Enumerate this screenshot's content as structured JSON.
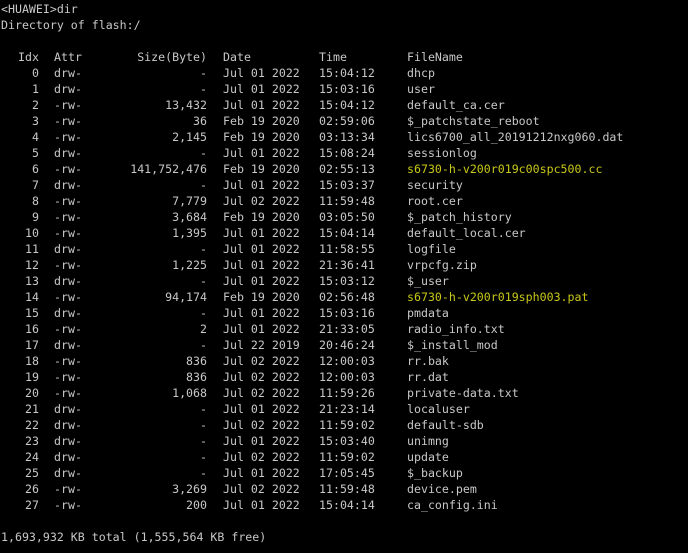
{
  "terminal": {
    "prompt": "<HUAWEI>dir",
    "directory": "Directory of flash:/",
    "headers": {
      "idx": "Idx",
      "attr": "Attr",
      "size": "Size(Byte)",
      "date": "Date",
      "time": "Time",
      "filename": "FileName"
    },
    "rows": [
      {
        "idx": "0",
        "attr": "drw-",
        "size": "-",
        "date": "Jul 01 2022",
        "time": "15:04:12",
        "name": "dhcp",
        "highlight": false
      },
      {
        "idx": "1",
        "attr": "drw-",
        "size": "-",
        "date": "Jul 01 2022",
        "time": "15:03:16",
        "name": "user",
        "highlight": false
      },
      {
        "idx": "2",
        "attr": "-rw-",
        "size": "13,432",
        "date": "Jul 01 2022",
        "time": "15:04:12",
        "name": "default_ca.cer",
        "highlight": false
      },
      {
        "idx": "3",
        "attr": "-rw-",
        "size": "36",
        "date": "Feb 19 2020",
        "time": "02:59:06",
        "name": "$_patchstate_reboot",
        "highlight": false
      },
      {
        "idx": "4",
        "attr": "-rw-",
        "size": "2,145",
        "date": "Feb 19 2020",
        "time": "03:13:34",
        "name": "lics6700_all_20191212nxg060.dat",
        "highlight": false
      },
      {
        "idx": "5",
        "attr": "drw-",
        "size": "-",
        "date": "Jul 01 2022",
        "time": "15:08:24",
        "name": "sessionlog",
        "highlight": false
      },
      {
        "idx": "6",
        "attr": "-rw-",
        "size": "141,752,476",
        "date": "Feb 19 2020",
        "time": "02:55:13",
        "name": "s6730-h-v200r019c00spc500.cc",
        "highlight": true
      },
      {
        "idx": "7",
        "attr": "drw-",
        "size": "-",
        "date": "Jul 01 2022",
        "time": "15:03:37",
        "name": "security",
        "highlight": false
      },
      {
        "idx": "8",
        "attr": "-rw-",
        "size": "7,779",
        "date": "Jul 02 2022",
        "time": "11:59:48",
        "name": "root.cer",
        "highlight": false
      },
      {
        "idx": "9",
        "attr": "-rw-",
        "size": "3,684",
        "date": "Feb 19 2020",
        "time": "03:05:50",
        "name": "$_patch_history",
        "highlight": false
      },
      {
        "idx": "10",
        "attr": "-rw-",
        "size": "1,395",
        "date": "Jul 01 2022",
        "time": "15:04:14",
        "name": "default_local.cer",
        "highlight": false
      },
      {
        "idx": "11",
        "attr": "drw-",
        "size": "-",
        "date": "Jul 01 2022",
        "time": "11:58:55",
        "name": "logfile",
        "highlight": false
      },
      {
        "idx": "12",
        "attr": "-rw-",
        "size": "1,225",
        "date": "Jul 01 2022",
        "time": "21:36:41",
        "name": "vrpcfg.zip",
        "highlight": false
      },
      {
        "idx": "13",
        "attr": "drw-",
        "size": "-",
        "date": "Jul 01 2022",
        "time": "15:03:12",
        "name": "$_user",
        "highlight": false
      },
      {
        "idx": "14",
        "attr": "-rw-",
        "size": "94,174",
        "date": "Feb 19 2020",
        "time": "02:56:48",
        "name": "s6730-h-v200r019sph003.pat",
        "highlight": true
      },
      {
        "idx": "15",
        "attr": "drw-",
        "size": "-",
        "date": "Jul 01 2022",
        "time": "15:03:16",
        "name": "pmdata",
        "highlight": false
      },
      {
        "idx": "16",
        "attr": "-rw-",
        "size": "2",
        "date": "Jul 01 2022",
        "time": "21:33:05",
        "name": "radio_info.txt",
        "highlight": false
      },
      {
        "idx": "17",
        "attr": "drw-",
        "size": "-",
        "date": "Jul 22 2019",
        "time": "20:46:24",
        "name": "$_install_mod",
        "highlight": false
      },
      {
        "idx": "18",
        "attr": "-rw-",
        "size": "836",
        "date": "Jul 02 2022",
        "time": "12:00:03",
        "name": "rr.bak",
        "highlight": false
      },
      {
        "idx": "19",
        "attr": "-rw-",
        "size": "836",
        "date": "Jul 02 2022",
        "time": "12:00:03",
        "name": "rr.dat",
        "highlight": false
      },
      {
        "idx": "20",
        "attr": "-rw-",
        "size": "1,068",
        "date": "Jul 02 2022",
        "time": "11:59:26",
        "name": "private-data.txt",
        "highlight": false
      },
      {
        "idx": "21",
        "attr": "drw-",
        "size": "-",
        "date": "Jul 01 2022",
        "time": "21:23:14",
        "name": "localuser",
        "highlight": false
      },
      {
        "idx": "22",
        "attr": "drw-",
        "size": "-",
        "date": "Jul 02 2022",
        "time": "11:59:02",
        "name": "default-sdb",
        "highlight": false
      },
      {
        "idx": "23",
        "attr": "drw-",
        "size": "-",
        "date": "Jul 01 2022",
        "time": "15:03:40",
        "name": "unimng",
        "highlight": false
      },
      {
        "idx": "24",
        "attr": "drw-",
        "size": "-",
        "date": "Jul 02 2022",
        "time": "11:59:02",
        "name": "update",
        "highlight": false
      },
      {
        "idx": "25",
        "attr": "drw-",
        "size": "-",
        "date": "Jul 01 2022",
        "time": "17:05:45",
        "name": "$_backup",
        "highlight": false
      },
      {
        "idx": "26",
        "attr": "-rw-",
        "size": "3,269",
        "date": "Jul 02 2022",
        "time": "11:59:48",
        "name": "device.pem",
        "highlight": false
      },
      {
        "idx": "27",
        "attr": "-rw-",
        "size": "200",
        "date": "Jul 01 2022",
        "time": "15:04:14",
        "name": "ca_config.ini",
        "highlight": false
      }
    ],
    "summary": "1,693,932 KB total (1,555,564 KB free)",
    "colors": {
      "background": "#000000",
      "text": "#c8c8c8",
      "highlight": "#c8c819"
    }
  }
}
